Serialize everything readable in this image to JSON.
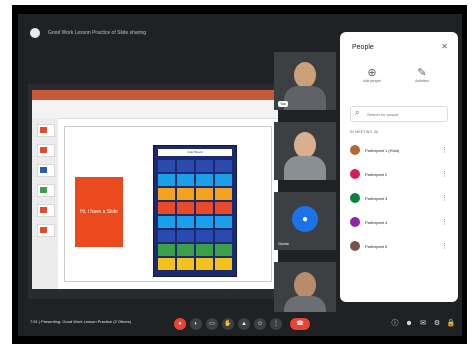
{
  "banner": {
    "text": "Good Work Lesson Practice of Slide sharing"
  },
  "presentation": {
    "slide_box_text": "Hi, I have a Slide",
    "board_header": "Quiz Board"
  },
  "video_tiles": [
    {
      "name": "You"
    },
    {
      "name": ""
    },
    {
      "name": "Guest"
    },
    {
      "name": ""
    }
  ],
  "people_panel": {
    "title": "People",
    "actions": [
      {
        "label": "Add people",
        "icon": "add-person-icon"
      },
      {
        "label": "Activities",
        "icon": "activities-icon"
      }
    ],
    "search_placeholder": "Search for people",
    "section_label": "IN MEETING (5)",
    "participants": [
      {
        "name": "Participant 1 (Host)",
        "color": "#b06a2c"
      },
      {
        "name": "Participant 2",
        "color": "#d81b60"
      },
      {
        "name": "Participant 3",
        "color": "#0b8043"
      },
      {
        "name": "Participant 4",
        "color": "#8e24aa"
      },
      {
        "name": "Participant 5",
        "color": "#795548"
      }
    ]
  },
  "bottom_bar": {
    "meeting_info": "7:51  |  Presenting: Good Work Lesson Practice (2 Others)"
  },
  "colors": {
    "accent": "#1a73e8",
    "danger": "#ea4335",
    "background": "#202124"
  }
}
